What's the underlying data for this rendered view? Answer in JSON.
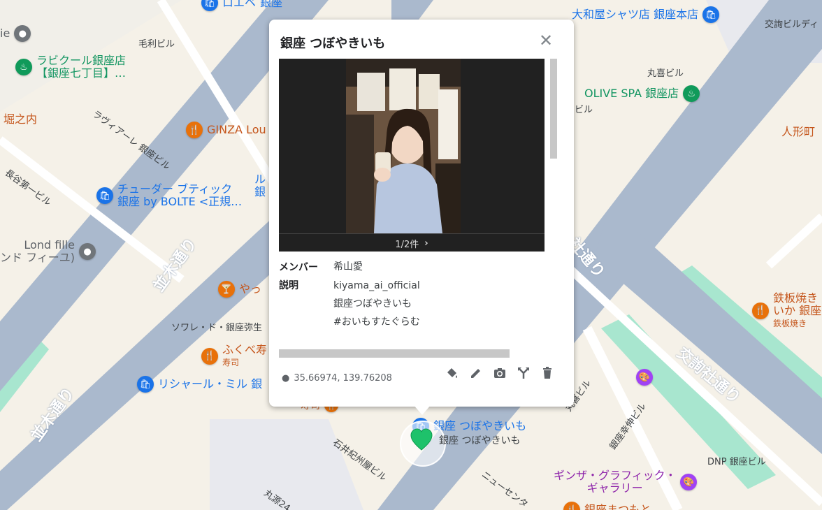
{
  "popup": {
    "title": "銀座 つぼやきいも",
    "counter": "1/2件",
    "member_label": "メンバー",
    "member_value": "希山愛",
    "desc_label": "説明",
    "desc_lines": [
      "kiyama_ai_official",
      "銀座つぼやきいも",
      "#おいもすたぐらむ"
    ],
    "coords": "35.66974, 139.76208"
  },
  "map": {
    "roads": [
      "並木通り",
      "並木通り",
      "交詢社通り",
      "社通り"
    ],
    "pois": [
      {
        "name": "ロエベ",
        "extra": "銀座",
        "color": "blue",
        "icon": "shopping-bag-icon"
      },
      {
        "name": "大和屋シャツ店 銀座本店",
        "color": "blue",
        "icon": "shopping-bag-icon"
      },
      {
        "name": "ラビクール銀座店",
        "name2": "【銀座七丁目】…",
        "color": "green",
        "icon": "spa-icon"
      },
      {
        "name": "OLIVE SPA 銀座店",
        "color": "green",
        "icon": "spa-icon"
      },
      {
        "name": "GINZA Lou",
        "color": "orange",
        "icon": "restaurant-icon"
      },
      {
        "name": "チューダー ブティック",
        "name2": "銀座 by BOLTE <正規…",
        "color": "blue",
        "icon": "shopping-bag-icon"
      },
      {
        "name": "Lond fille",
        "name2": "ンド フィーユ)",
        "color": "grey",
        "icon": "place-icon"
      },
      {
        "name": "やっ",
        "color": "orange",
        "icon": "bar-icon"
      },
      {
        "name": "ふくべ寿",
        "sub": "寿司",
        "color": "orange",
        "icon": "restaurant-icon"
      },
      {
        "name": "リシャール・ミル 銀",
        "color": "blue",
        "icon": "shopping-bag-icon"
      },
      {
        "name": "鉄板焼き",
        "name2": "いか 銀座",
        "sub": "鉄板焼き",
        "color": "orange",
        "icon": "restaurant-icon"
      },
      {
        "name": "ギンザ・グラフィック・",
        "name2": "ギャラリー",
        "color": "purple",
        "icon": "art-gallery-icon"
      },
      {
        "name": "銀座 つぼやきいも",
        "color": "blue",
        "icon": "shopping-bag-icon"
      },
      {
        "name": "銀座まつもと",
        "color": "orange",
        "icon": "restaurant-icon"
      }
    ],
    "buildings": [
      "毛利ビル",
      "丸喜ビル",
      "交詢ビルディ",
      "ラヴィアーレ 銀座ビル",
      "長谷第一ビル",
      "ソワレ・ド・銀座弥生",
      "石井紀州屋ビル",
      "ニューセンタ",
      "DNP 銀座ビル",
      "銀座幸伸ビル",
      "丸源24",
      "丸喜ビル",
      "堀之内",
      "人形町",
      "ie",
      "ル",
      "銀",
      "ビル",
      "ルビル"
    ],
    "marker_label": "銀座 つぼやきいも",
    "marker_sub": "寿司"
  },
  "colors": {
    "accent": "#1a73e8",
    "marker": "#1ec26b",
    "road": "#aab9cd",
    "park": "#a8e6cf"
  }
}
